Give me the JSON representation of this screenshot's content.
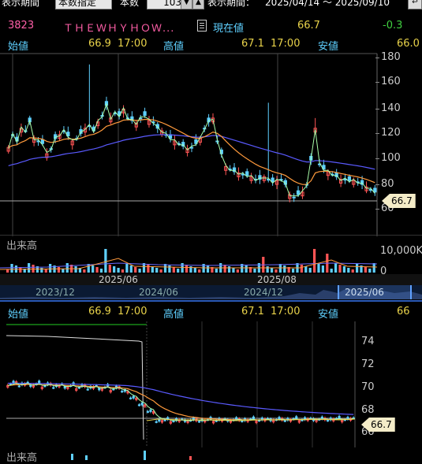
{
  "settings_bar": {
    "period_label": "表示期間",
    "period_mode": "本数指定",
    "count_label": "本数",
    "count_value": "103",
    "range_label": "表示期間：",
    "range_value": "2025/04/14 ～ 2025/09/10",
    "back_icon": "return-arrow-icon"
  },
  "quote_header": {
    "code": "3823",
    "name": "ＴＨＥＷＨＹＨＯＷ...",
    "current_label": "現在値",
    "current_value": "66.7",
    "change": "-0.3",
    "memo_icon": "memo-icon"
  },
  "upper_chart": {
    "open_label": "始値",
    "open_value": "66.9",
    "open_time": "17:00",
    "high_label": "高値",
    "high_value": "67.1",
    "high_time": "17:00",
    "low_label": "安値",
    "low_value": "66.0",
    "y_ticks": [
      "180",
      "160",
      "140",
      "120",
      "100",
      "80",
      "60"
    ],
    "price_badge": "66.7",
    "volume_label": "出来高",
    "volume_tick": "10,000K",
    "volume_zero": "0",
    "x_labels": [
      "2025/06",
      "2025/08"
    ],
    "nav_labels": [
      "2023/12",
      "2024/06",
      "2024/12",
      "2025/06"
    ]
  },
  "lower_chart": {
    "open_label": "始値",
    "open_value": "66.9",
    "open_time": "17:00",
    "high_label": "高値",
    "high_value": "67.1",
    "high_time": "17:00",
    "low_label": "安値",
    "low_value": "66",
    "y_ticks": [
      "74",
      "72",
      "70",
      "68",
      "66"
    ],
    "price_badge": "66.7",
    "volume_label": "出来高"
  },
  "colors": {
    "candle_up": "#ff5555",
    "candle_down": "#5fd0ff",
    "ma_short": "#aaffaa",
    "ma_mid": "#ff9a3c",
    "ma_long": "#5a5aff",
    "price_badge_bg": "#f4ecc8"
  }
}
